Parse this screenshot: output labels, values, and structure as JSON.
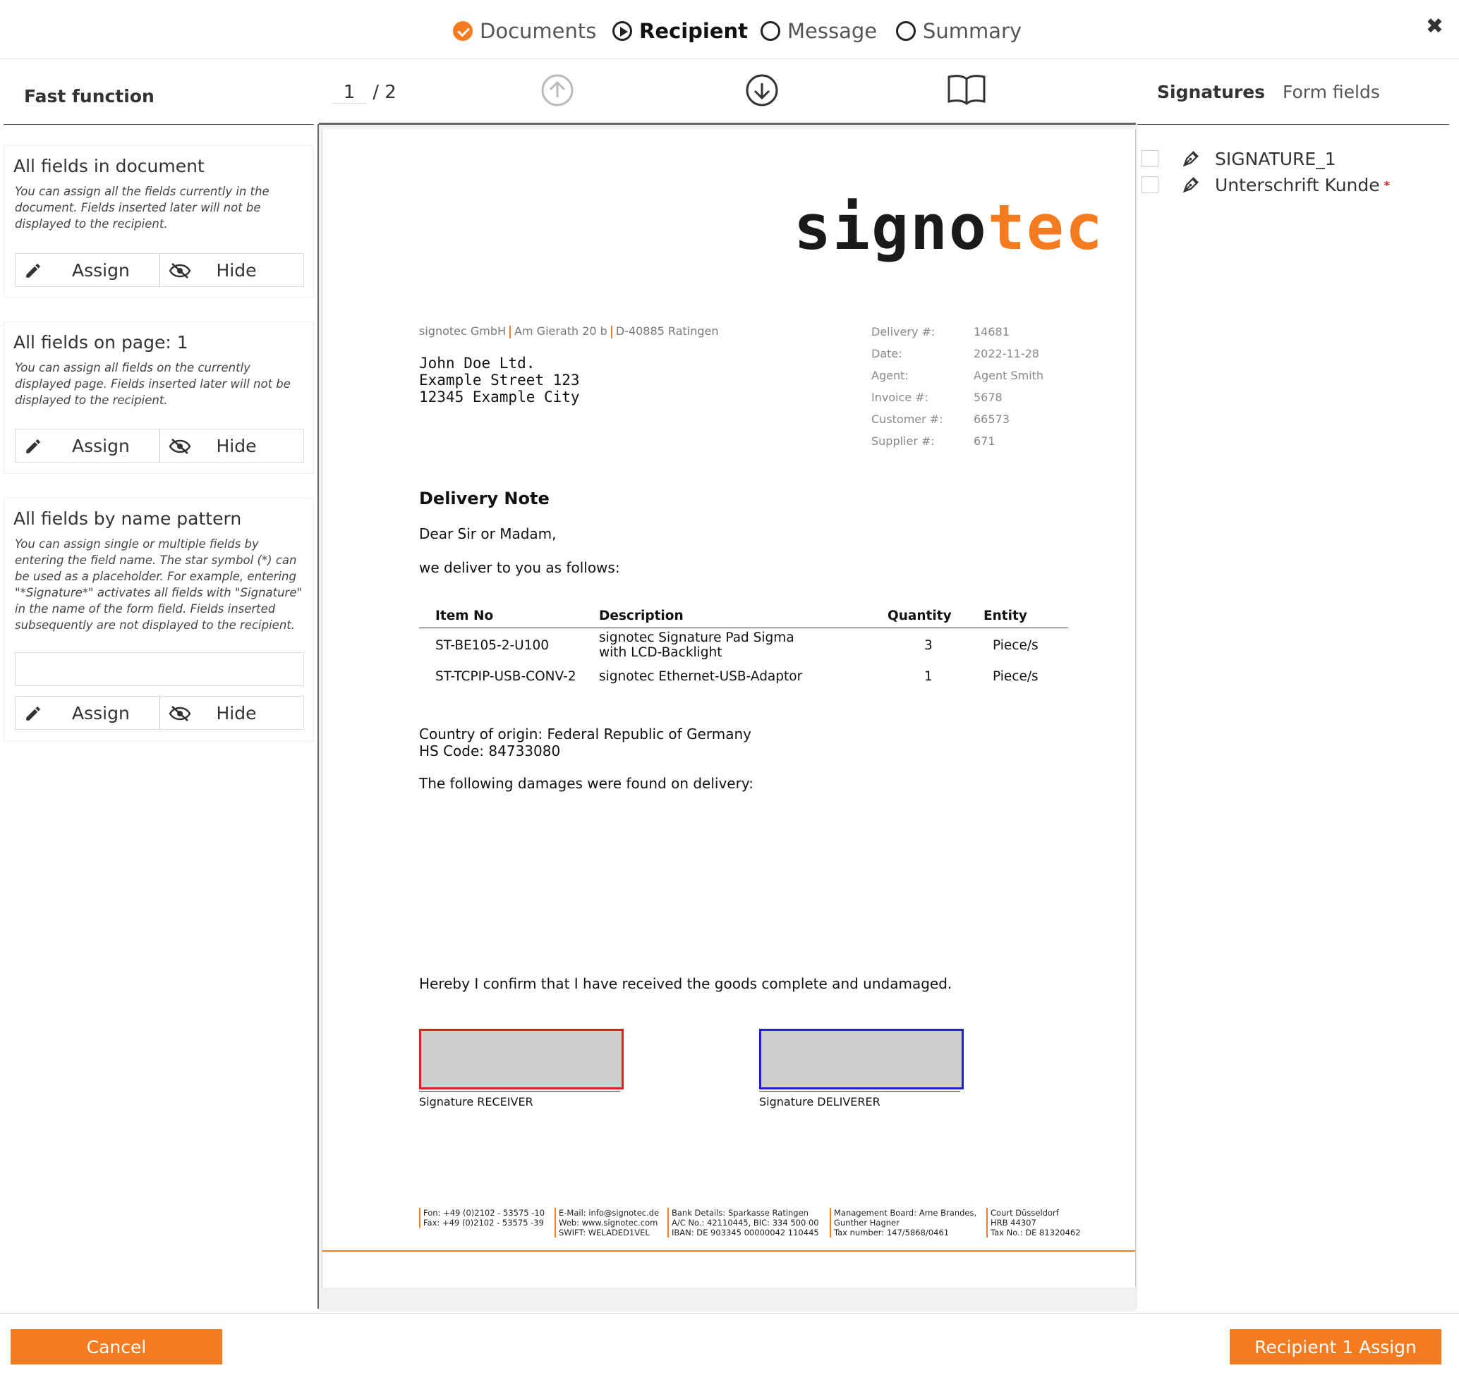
{
  "steps": [
    {
      "label": "Documents",
      "state": "done"
    },
    {
      "label": "Recipient",
      "state": "active"
    },
    {
      "label": "Message",
      "state": "pending"
    },
    {
      "label": "Summary",
      "state": "pending"
    }
  ],
  "left_panel": {
    "title": "Fast function",
    "cards": [
      {
        "title": "All fields in document",
        "desc": "You can assign all the fields currently in the document. Fields inserted later will not be displayed to the recipient.",
        "assign": "Assign",
        "hide": "Hide"
      },
      {
        "title": "All fields on page: 1",
        "desc": "You can assign all fields on the currently displayed page. Fields inserted later will not be displayed to the recipient.",
        "assign": "Assign",
        "hide": "Hide"
      },
      {
        "title": "All fields by name pattern",
        "desc": "You can assign single or multiple fields by entering the field name. The star symbol (*) can be used as a placeholder. For example, entering \"*Signature*\" activates all fields with \"Signature\" in the name of the form field. Fields inserted subsequently are not displayed to the recipient.",
        "input_value": "",
        "assign": "Assign",
        "hide": "Hide"
      }
    ]
  },
  "pager": {
    "current": "1",
    "total": "/ 2"
  },
  "document": {
    "logo_a": "signo",
    "logo_b": "tec",
    "sender": [
      "signotec GmbH",
      "Am Gierath 20 b",
      "D-40885 Ratingen"
    ],
    "address": [
      "John Doe Ltd.",
      "Example Street 123",
      "12345 Example City"
    ],
    "meta": [
      {
        "k": "Delivery #:",
        "v": "14681"
      },
      {
        "k": "Date:",
        "v": "2022-11-28"
      },
      {
        "k": "Agent:",
        "v": "Agent Smith"
      },
      {
        "k": "Invoice #:",
        "v": "5678"
      },
      {
        "k": "Customer #:",
        "v": "66573"
      },
      {
        "k": "Supplier #:",
        "v": "671"
      }
    ],
    "title": "Delivery Note",
    "greeting": "Dear Sir or Madam,",
    "intro": "we deliver to you as follows:",
    "table": {
      "headers": [
        "Item No",
        "Description",
        "Quantity",
        "Entity"
      ],
      "rows": [
        [
          "ST-BE105-2-U100",
          "signotec Signature Pad Sigma",
          "with LCD-Backlight",
          "3",
          "Piece/s"
        ],
        [
          "ST-TCPIP-USB-CONV-2",
          "signotec Ethernet-USB-Adaptor",
          "",
          "1",
          "Piece/s"
        ]
      ]
    },
    "origin": "Country of origin: Federal Republic of Germany",
    "hs_code": "HS Code: 84733080",
    "damages": "The following damages were found on delivery:",
    "confirm": "Hereby I confirm that I have received the goods complete and undamaged.",
    "sig_receiver": "Signature RECEIVER",
    "sig_deliverer": "Signature DELIVERER",
    "footer": [
      [
        "Fon: +49 (0)2102 - 53575 -10",
        "Fax: +49 (0)2102 - 53575 -39",
        ""
      ],
      [
        "E-Mail: info@signotec.de",
        "Web: www.signotec.com",
        "SWIFT: WELADED1VEL"
      ],
      [
        "Bank Details: Sparkasse Ratingen",
        "A/C No.: 42110445, BIC: 334 500 00",
        "IBAN: DE 903345 00000042 110445"
      ],
      [
        "Management Board: Arne Brandes,",
        "Gunther Hagner",
        "Tax number: 147/5868/0461"
      ],
      [
        "Court  Düsseldorf",
        "HRB 44307",
        "Tax No.: DE 81320462"
      ]
    ]
  },
  "right_panel": {
    "tabs": [
      "Signatures",
      "Form fields"
    ],
    "items": [
      {
        "name": "SIGNATURE_1",
        "required": false
      },
      {
        "name": "Unterschrift Kunde",
        "required": true,
        "req_mark": "*"
      }
    ]
  },
  "footer_bar": {
    "cancel": "Cancel",
    "assign": "Recipient 1 Assign"
  },
  "colors": {
    "accent": "#f47b20",
    "receiver_box": "#e02020",
    "deliverer_box": "#2020d0"
  }
}
